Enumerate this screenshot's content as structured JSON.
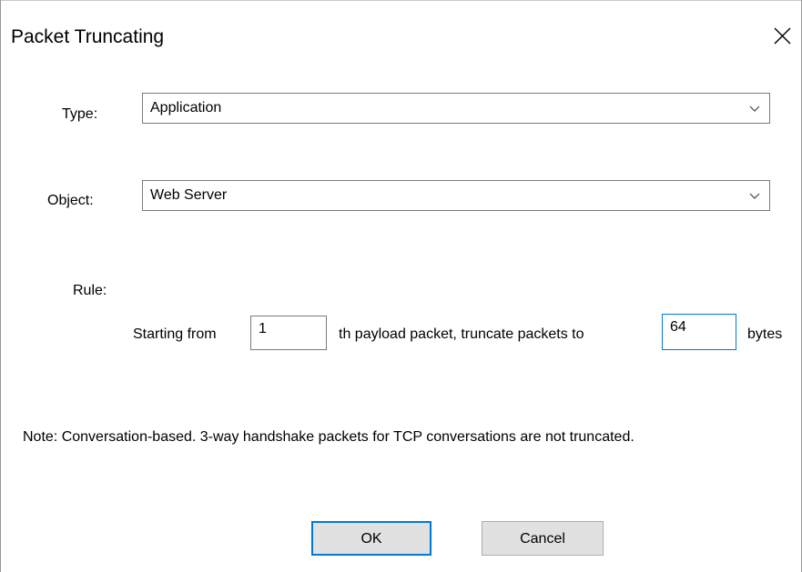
{
  "dialog": {
    "title": "Packet Truncating",
    "close_icon": "close-icon"
  },
  "type_field": {
    "label": "Type:",
    "value": "Application",
    "arrow_icon": "chevron-down-icon"
  },
  "object_field": {
    "label": "Object:",
    "value": "Web Server",
    "arrow_icon": "chevron-down-icon"
  },
  "rule": {
    "label": "Rule:",
    "prefix": "Starting from",
    "start_packet": "1",
    "middle": "th payload packet, truncate packets to",
    "byte_count": "64",
    "suffix": "bytes"
  },
  "note": "Note: Conversation-based. 3-way handshake packets for TCP conversations are not truncated.",
  "buttons": {
    "ok": "OK",
    "cancel": "Cancel"
  },
  "colors": {
    "focus_border": "#0078d7",
    "button_face": "#e1e1e1",
    "input_border": "#7a7a7a"
  }
}
